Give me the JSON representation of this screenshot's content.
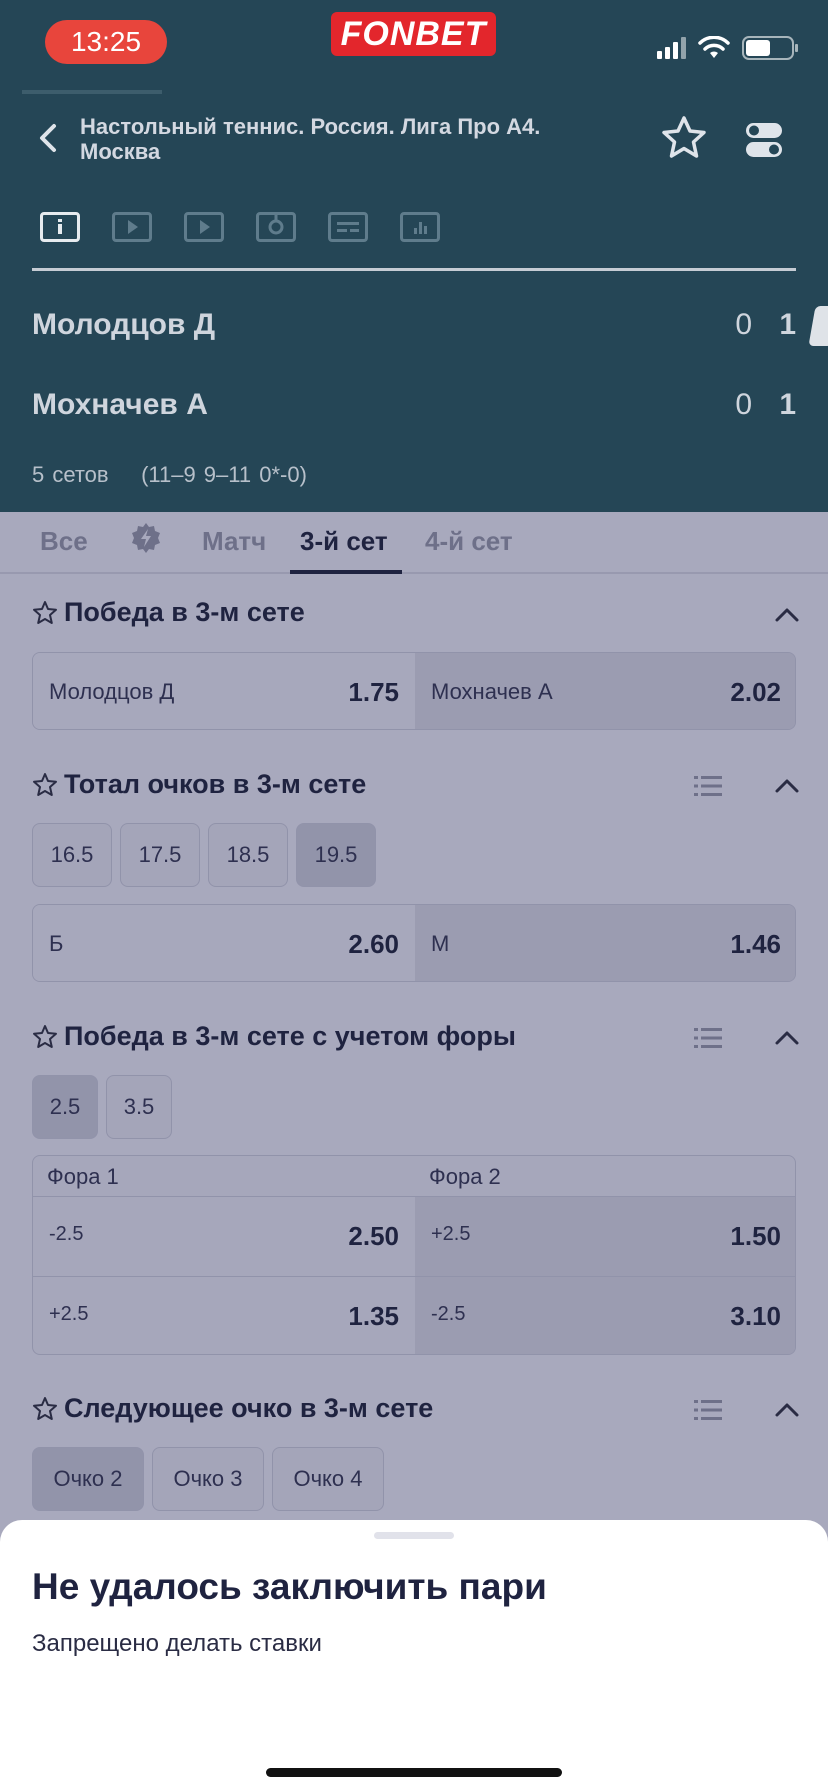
{
  "status_bar": {
    "time": "13:25",
    "brand": "FONBET"
  },
  "header": {
    "league": "Настольный теннис. Россия. Лига Про А4. Москва",
    "players": [
      {
        "name": "Молодцов Д",
        "sets": "0",
        "points": "1"
      },
      {
        "name": "Мохначев А",
        "sets": "0",
        "points": "1"
      }
    ],
    "format": "5 сетов",
    "score_detail": "(11–9 9–11 0*-0)",
    "media_tabs": [
      "info-icon",
      "video-icon",
      "video-icon",
      "tracker-icon",
      "scoreboard-icon",
      "stats-icon"
    ]
  },
  "tabs": {
    "all": "Все",
    "match": "Матч",
    "set3": "3-й сет",
    "set4": "4-й сет",
    "active": "3-й сет"
  },
  "markets": {
    "win_set": {
      "title": "Победа в 3-м сете",
      "left_label": "Молодцов Д",
      "left_odds": "1.75",
      "right_label": "Мохначев А",
      "right_odds": "2.02"
    },
    "total": {
      "title": "Тотал очков в 3-м сете",
      "options": [
        "16.5",
        "17.5",
        "18.5",
        "19.5"
      ],
      "selected": "19.5",
      "left_label": "Б",
      "left_odds": "2.60",
      "right_label": "М",
      "right_odds": "1.46"
    },
    "handicap": {
      "title": "Победа в 3-м сете с учетом форы",
      "options": [
        "2.5",
        "3.5"
      ],
      "selected": "2.5",
      "col1": "Фора 1",
      "col2": "Фора 2",
      "rows": [
        {
          "l_label": "-2.5",
          "l_odds": "2.50",
          "r_label": "+2.5",
          "r_odds": "1.50"
        },
        {
          "l_label": "+2.5",
          "l_odds": "1.35",
          "r_label": "-2.5",
          "r_odds": "3.10"
        }
      ]
    },
    "next_point": {
      "title": "Следующее очко в 3-м сете",
      "options": [
        "Очко 2",
        "Очко 3",
        "Очко 4"
      ],
      "selected": "Очко 2"
    }
  },
  "sheet": {
    "title": "Не удалось заключить пари",
    "message": "Запрещено делать ставки"
  }
}
